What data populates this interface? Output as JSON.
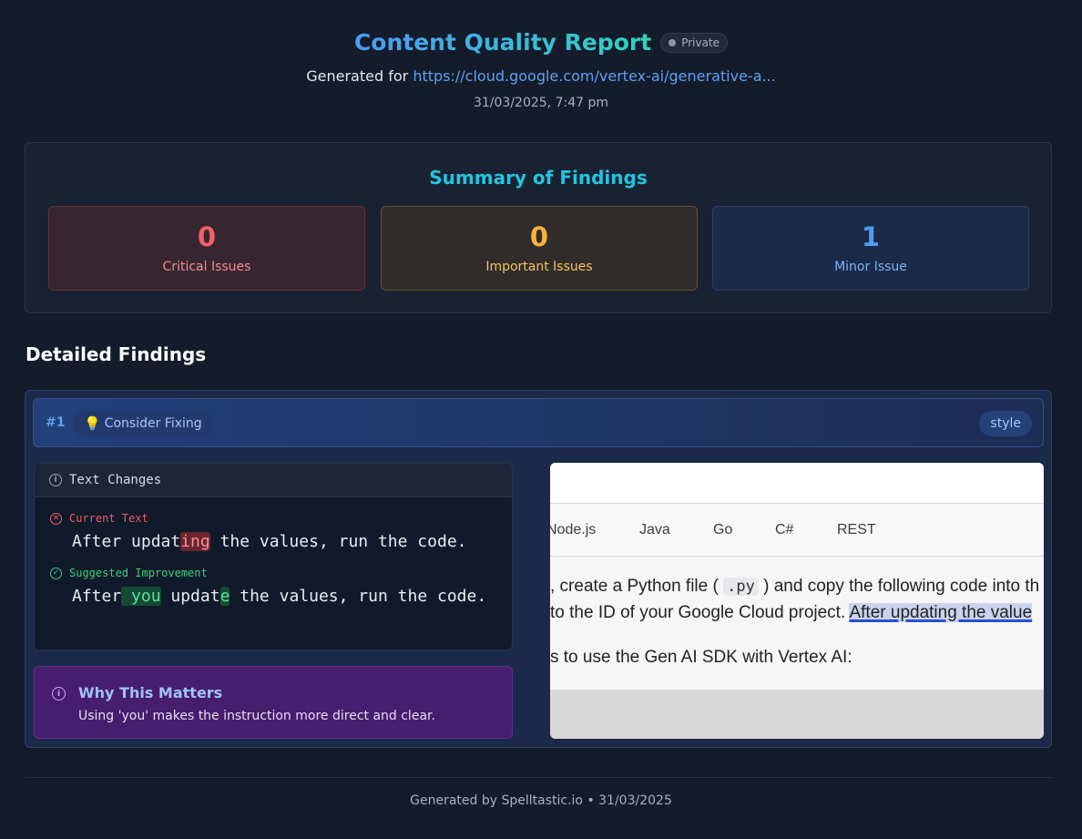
{
  "header": {
    "title": "Content Quality Report",
    "privacy_badge": "Private",
    "generated_prefix": "Generated for ",
    "generated_url": "https://cloud.google.com/vertex-ai/generative-a...",
    "date": "31/03/2025, 7:47 pm"
  },
  "summary": {
    "title": "Summary of Findings",
    "critical": {
      "count": "0",
      "label": "Critical Issues",
      "color": "#f25f66"
    },
    "important": {
      "count": "0",
      "label": "Important Issues",
      "color": "#f6b23b"
    },
    "minor": {
      "count": "1",
      "label": "Minor Issue",
      "color": "#4f9cf5"
    }
  },
  "detailed": {
    "title": "Detailed Findings",
    "findings": [
      {
        "number": "#1",
        "severity_icon": "lightbulb-icon",
        "severity": "Consider Fixing",
        "category": "style",
        "changes_title": "Text Changes",
        "current_label": "Current Text",
        "current_parts": [
          "After updat",
          "ing",
          " the values, run the code."
        ],
        "suggested_label": "Suggested Improvement",
        "suggested_parts": [
          "After",
          " you",
          " updat",
          "e",
          " the values, run the code."
        ],
        "why_title": "Why This Matters",
        "why_text": "Using 'you' makes the instruction more direct and clear.",
        "screenshot": {
          "tabs": [
            "Node.js",
            "Java",
            "Go",
            "C#",
            "REST"
          ],
          "line1_pre": ", create a Python file (",
          "line1_code": ".py",
          "line1_post": ") and copy the following code into th",
          "line2_pre": " to the ID of your Google Cloud project. ",
          "line2_hl": "After updating the value",
          "line3": "s to use the Gen AI SDK with Vertex AI:"
        }
      }
    ]
  },
  "footer": {
    "text": "Generated by Spelltastic.io • 31/03/2025"
  }
}
